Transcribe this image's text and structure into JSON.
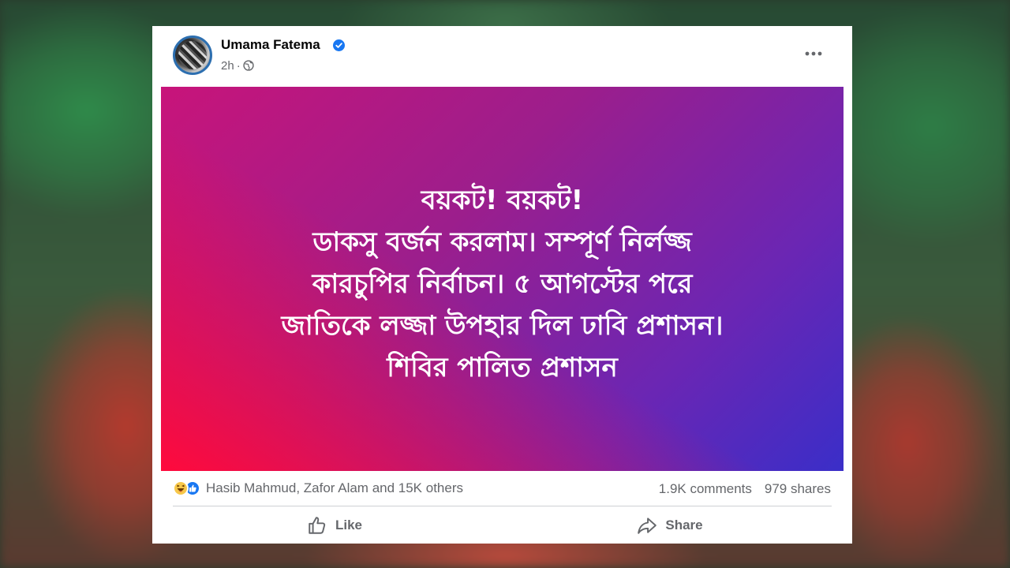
{
  "post": {
    "author": "Umama Fatema",
    "time": "2h",
    "meta_separator": "·",
    "text_lines": [
      "বয়কট! বয়কট!",
      "ডাকসু বর্জন করলাম। সম্পূর্ণ নির্লজ্জ",
      "কারচুপির নির্বাচন। ৫ আগস্টের পরে",
      "জাতিকে লজ্জা উপহার দিল ঢাবি প্রশাসন।",
      "শিবির পালিত প্রশাসন"
    ],
    "background_gradient": [
      "#ff0a3c",
      "#c8147a",
      "#6a26b4",
      "#3a2ec8"
    ]
  },
  "stats": {
    "reaction_icons": [
      "haha-icon",
      "like-icon"
    ],
    "reactors": "Hasib Mahmud, Zafor Alam and 15K others",
    "comments": "1.9K comments",
    "shares": "979 shares"
  },
  "actions": {
    "like_label": "Like",
    "share_label": "Share"
  },
  "icons": {
    "verified": "verified-badge-icon",
    "privacy": "globe-icon",
    "more": "more-options-icon"
  },
  "colors": {
    "verified_blue": "#1877f2",
    "secondary_text": "#65676b",
    "primary_text": "#050505"
  }
}
